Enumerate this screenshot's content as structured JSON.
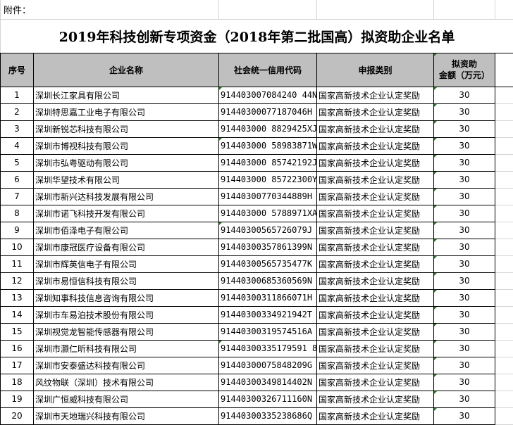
{
  "attachment_label": "附件：",
  "title": "2019年科技创新专项资金（2018年第二批国高）拟资助企业名单",
  "headers": {
    "no": "序号",
    "name": "企业名称",
    "code": "社会统一信用代码",
    "type": "申报类别",
    "amount_line1": "拟资助",
    "amount_line2": "金额（万元）"
  },
  "rows": [
    {
      "no": "1",
      "name": "深圳长江家具有限公司",
      "code": "914403007084240 44N",
      "type": "国家高新技术企业认定奖励",
      "amount": "30"
    },
    {
      "no": "2",
      "name": "深圳特思嘉工业电子有限公司",
      "code": "91440300077187046H",
      "type": "国家高新技术企业认定奖励",
      "amount": "30"
    },
    {
      "no": "3",
      "name": "深圳新锐芯科技有限公司",
      "code": "914403000 8829425XJ",
      "type": "国家高新技术企业认定奖励",
      "amount": "30"
    },
    {
      "no": "4",
      "name": "深圳市博视科技有限公司",
      "code": "914403000 58983871W",
      "type": "国家高新技术企业认定奖励",
      "amount": "30"
    },
    {
      "no": "5",
      "name": "深圳市弘粤驱动有限公司",
      "code": "914403000 85742192J",
      "type": "国家高新技术企业认定奖励",
      "amount": "30"
    },
    {
      "no": "6",
      "name": "深圳华望技术有限公司",
      "code": "914403000 85722300Y",
      "type": "国家高新技术企业认定奖励",
      "amount": "30"
    },
    {
      "no": "7",
      "name": "深圳市新兴达科技发展有限公司",
      "code": "91440300770344889H",
      "type": "国家高新技术企业认定奖励",
      "amount": "30"
    },
    {
      "no": "8",
      "name": "深圳市诺飞科技开发有限公司",
      "code": "914403000 5788971XA",
      "type": "国家高新技术企业认定奖励",
      "amount": "30"
    },
    {
      "no": "9",
      "name": "深圳市佰泽电子有限公司",
      "code": "91440300565726079J",
      "type": "国家高新技术企业认定奖励",
      "amount": "30"
    },
    {
      "no": "10",
      "name": "深圳市康冠医疗设备有限公司",
      "code": "91440300357861399N",
      "type": "国家高新技术企业认定奖励",
      "amount": "30"
    },
    {
      "no": "11",
      "name": "深圳市辉英信电子有限公司",
      "code": "91440300565735477K",
      "type": "国家高新技术企业认定奖励",
      "amount": "30"
    },
    {
      "no": "12",
      "name": "深圳市易恒信科技有限公司",
      "code": "91440300685360569N",
      "type": "国家高新技术企业认定奖励",
      "amount": "30"
    },
    {
      "no": "13",
      "name": "深圳知事科技信息咨询有限公司",
      "code": "91440300311866071H",
      "type": "国家高新技术企业认定奖励",
      "amount": "30"
    },
    {
      "no": "14",
      "name": "深圳市车易泊技术股份有限公司",
      "code": "91440300334921942T",
      "type": "国家高新技术企业认定奖励",
      "amount": "30"
    },
    {
      "no": "15",
      "name": "深圳视觉龙智能传感器有限公司",
      "code": "91440300319574516A",
      "type": "国家高新技术企业认定奖励",
      "amount": "30"
    },
    {
      "no": "16",
      "name": "深圳市灏仁昕科技有限公司",
      "code": "91440300335179591 8",
      "type": "国家高新技术企业认定奖励",
      "amount": "30"
    },
    {
      "no": "17",
      "name": "深圳市安泰盛达科技有限公司",
      "code": "91440300075848209G",
      "type": "国家高新技术企业认定奖励",
      "amount": "30"
    },
    {
      "no": "18",
      "name": "风纹物联（深圳）技术有限公司",
      "code": "91440300349814402N",
      "type": "国家高新技术企业认定奖励",
      "amount": "30"
    },
    {
      "no": "19",
      "name": "深圳广恒威科技有限公司",
      "code": "91440300326711160N",
      "type": "国家高新技术企业认定奖励",
      "amount": "30"
    },
    {
      "no": "20",
      "name": "深圳市天地瑞兴科技有限公司",
      "code": "91440300335238686Q",
      "type": "国家高新技术企业认定奖励",
      "amount": "30"
    }
  ]
}
